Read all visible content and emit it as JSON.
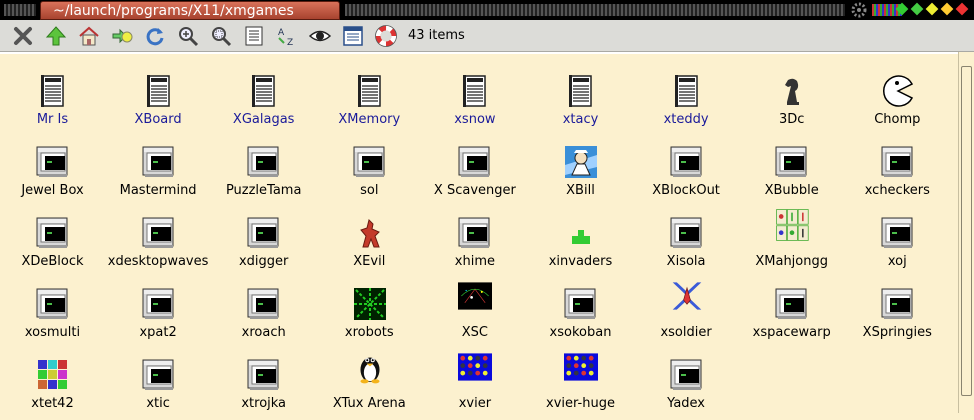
{
  "window": {
    "title": "~/launch/programs/X11/xmgames"
  },
  "toolbar": {
    "buttons": [
      {
        "name": "close-button",
        "icon": "close-icon"
      },
      {
        "name": "up-button",
        "icon": "up-arrow-icon"
      },
      {
        "name": "home-button",
        "icon": "home-icon"
      },
      {
        "name": "goto-button",
        "icon": "goto-icon"
      },
      {
        "name": "refresh-button",
        "icon": "refresh-icon"
      },
      {
        "name": "zoom-in-button",
        "icon": "zoom-in-icon"
      },
      {
        "name": "zoom-fit-button",
        "icon": "zoom-fit-icon"
      },
      {
        "name": "details-button",
        "icon": "details-icon"
      },
      {
        "name": "sort-button",
        "icon": "sort-az-icon"
      },
      {
        "name": "show-hidden-button",
        "icon": "eye-icon"
      },
      {
        "name": "list-view-button",
        "icon": "list-icon"
      },
      {
        "name": "help-button",
        "icon": "lifebuoy-icon"
      }
    ],
    "item_count": "43 items"
  },
  "items": [
    {
      "label": "Mr Is",
      "icon": "script",
      "link": true
    },
    {
      "label": "XBoard",
      "icon": "script",
      "link": true
    },
    {
      "label": "XGalagas",
      "icon": "script",
      "link": true
    },
    {
      "label": "XMemory",
      "icon": "script",
      "link": true
    },
    {
      "label": "xsnow",
      "icon": "script",
      "link": true
    },
    {
      "label": "xtacy",
      "icon": "script",
      "link": true
    },
    {
      "label": "xteddy",
      "icon": "script",
      "link": true
    },
    {
      "label": "3Dc",
      "icon": "chess",
      "link": false
    },
    {
      "label": "Chomp",
      "icon": "pacman",
      "link": false
    },
    {
      "label": "Jewel Box",
      "icon": "terminal",
      "link": false
    },
    {
      "label": "Mastermind",
      "icon": "terminal",
      "link": false
    },
    {
      "label": "PuzzleTama",
      "icon": "terminal",
      "link": false
    },
    {
      "label": "sol",
      "icon": "terminal",
      "link": false
    },
    {
      "label": "X Scavenger",
      "icon": "terminal",
      "link": false
    },
    {
      "label": "XBill",
      "icon": "xbill",
      "link": false
    },
    {
      "label": "XBlockOut",
      "icon": "terminal",
      "link": false
    },
    {
      "label": "XBubble",
      "icon": "terminal",
      "link": false
    },
    {
      "label": "xcheckers",
      "icon": "terminal",
      "link": false
    },
    {
      "label": "XDeBlock",
      "icon": "terminal",
      "link": false
    },
    {
      "label": "xdesktopwaves",
      "icon": "terminal",
      "link": false
    },
    {
      "label": "xdigger",
      "icon": "terminal",
      "link": false
    },
    {
      "label": "XEvil",
      "icon": "xevil",
      "link": false
    },
    {
      "label": "xhime",
      "icon": "terminal",
      "link": false
    },
    {
      "label": "xinvaders",
      "icon": "invader",
      "link": false
    },
    {
      "label": "Xisola",
      "icon": "terminal",
      "link": false
    },
    {
      "label": "XMahjongg",
      "icon": "mahjong",
      "link": false
    },
    {
      "label": "xoj",
      "icon": "terminal",
      "link": false
    },
    {
      "label": "xosmulti",
      "icon": "terminal",
      "link": false
    },
    {
      "label": "xpat2",
      "icon": "terminal",
      "link": false
    },
    {
      "label": "xroach",
      "icon": "terminal",
      "link": false
    },
    {
      "label": "xrobots",
      "icon": "xrobots",
      "link": false
    },
    {
      "label": "XSC",
      "icon": "xsc",
      "link": false
    },
    {
      "label": "xsokoban",
      "icon": "terminal",
      "link": false
    },
    {
      "label": "xsoldier",
      "icon": "xsoldier",
      "link": false
    },
    {
      "label": "xspacewarp",
      "icon": "terminal",
      "link": false
    },
    {
      "label": "XSpringies",
      "icon": "terminal",
      "link": false
    },
    {
      "label": "xtet42",
      "icon": "tetris",
      "link": false
    },
    {
      "label": "xtic",
      "icon": "terminal",
      "link": false
    },
    {
      "label": "xtrojka",
      "icon": "terminal",
      "link": false
    },
    {
      "label": "XTux Arena",
      "icon": "tux",
      "link": false
    },
    {
      "label": "xvier",
      "icon": "connect4",
      "link": false
    },
    {
      "label": "xvier-huge",
      "icon": "connect4",
      "link": false
    },
    {
      "label": "Yadex",
      "icon": "terminal",
      "link": false
    }
  ],
  "colors": {
    "background": "#fcf1cf",
    "link_text": "#1a1a9a",
    "toolbar": "#dcdcd8",
    "title_tab": "#c05a44"
  }
}
